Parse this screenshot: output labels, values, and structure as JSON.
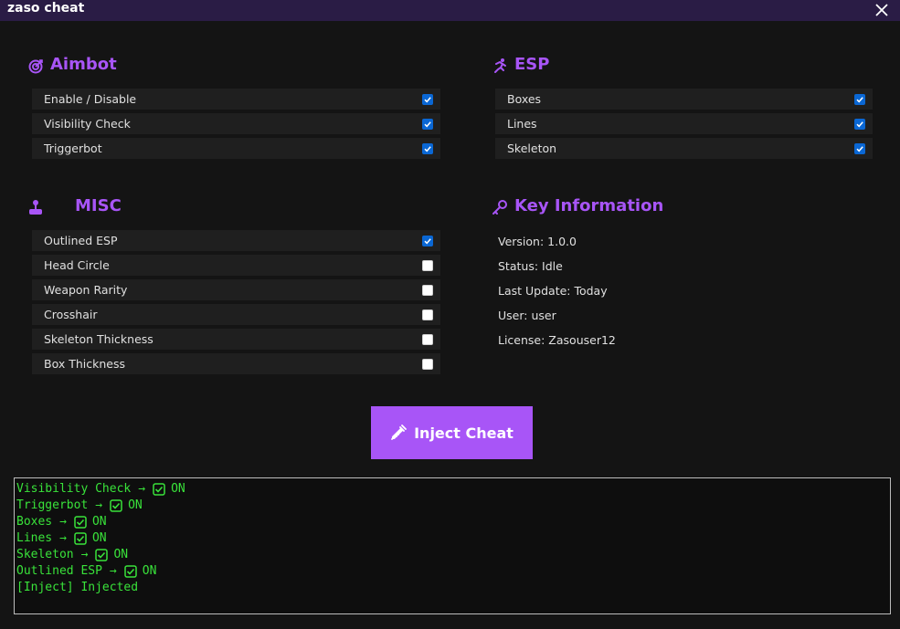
{
  "window": {
    "title": "zaso cheat"
  },
  "aimbot": {
    "title": "Aimbot",
    "items": [
      {
        "label": "Enable / Disable",
        "checked": true
      },
      {
        "label": "Visibility Check",
        "checked": true
      },
      {
        "label": "Triggerbot",
        "checked": true
      }
    ]
  },
  "esp": {
    "title": "ESP",
    "items": [
      {
        "label": "Boxes",
        "checked": true
      },
      {
        "label": "Lines",
        "checked": true
      },
      {
        "label": "Skeleton",
        "checked": true
      }
    ]
  },
  "misc": {
    "title": "MISC",
    "items": [
      {
        "label": "Outlined ESP",
        "checked": true
      },
      {
        "label": "Head Circle",
        "checked": false
      },
      {
        "label": "Weapon Rarity",
        "checked": false
      },
      {
        "label": "Crosshair",
        "checked": false
      },
      {
        "label": "Skeleton Thickness",
        "checked": false
      },
      {
        "label": "Box Thickness",
        "checked": false
      }
    ]
  },
  "key_info": {
    "title": "Key Information",
    "lines": [
      "Version: 1.0.0",
      "Status: Idle",
      "Last Update: Today",
      "User: user",
      "License: Zasouser12"
    ]
  },
  "inject_button": {
    "label": "Inject Cheat"
  },
  "console": {
    "lines": [
      {
        "name": "Visibility Check",
        "arrow": "→",
        "state": "ON"
      },
      {
        "name": "Triggerbot",
        "arrow": "→",
        "state": "ON"
      },
      {
        "name": "Boxes",
        "arrow": "→",
        "state": "ON"
      },
      {
        "name": "Lines",
        "arrow": "→",
        "state": "ON"
      },
      {
        "name": "Skeleton",
        "arrow": "→",
        "state": "ON"
      },
      {
        "name": "Outlined ESP",
        "arrow": "→",
        "state": "ON"
      }
    ],
    "final_line": "[Inject] Injected"
  },
  "colors": {
    "accent": "#a855f7",
    "titlebar": "#2a1c45",
    "checkbox_on": "#0a67d4",
    "console_text": "#39e23a"
  }
}
